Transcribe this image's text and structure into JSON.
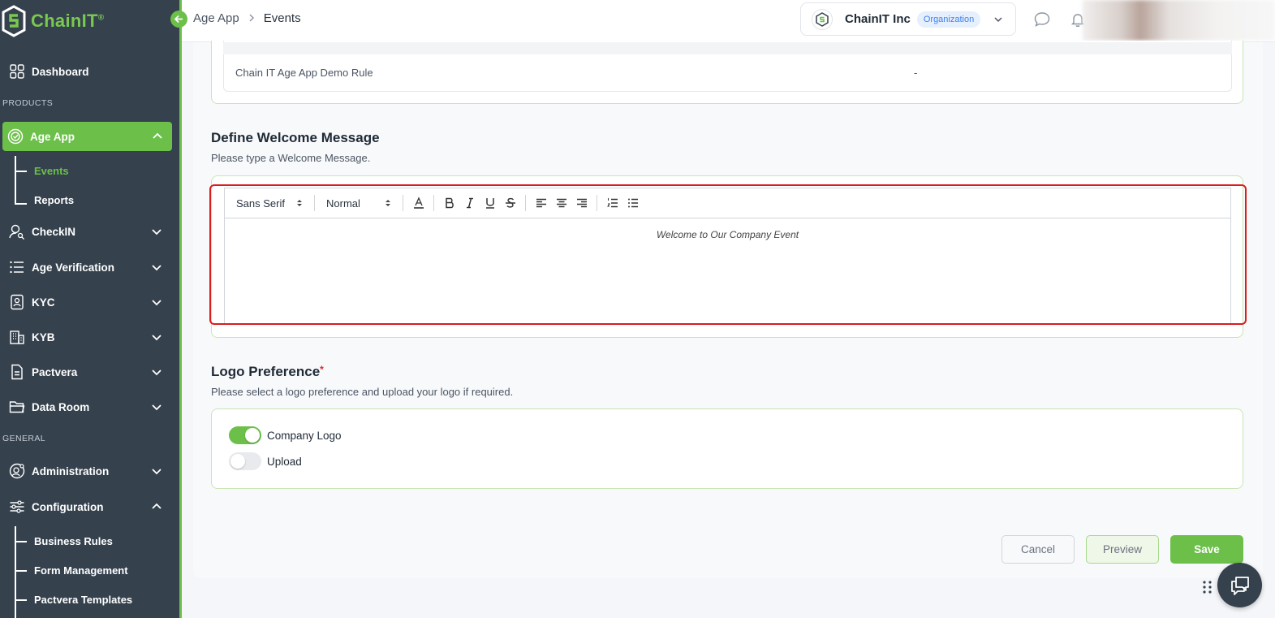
{
  "brand": {
    "name": "ChainIT",
    "reg": "®"
  },
  "sidebar": {
    "dashboard": "Dashboard",
    "section_products": "PRODUCTS",
    "age_app": "Age App",
    "age_app_sub": [
      "Events",
      "Reports"
    ],
    "checkin": "CheckIN",
    "age_verification": "Age Verification",
    "kyc": "KYC",
    "kyb": "KYB",
    "pactvera": "Pactvera",
    "data_room": "Data Room",
    "section_general": "GENERAL",
    "administration": "Administration",
    "configuration": "Configuration",
    "configuration_sub": [
      "Business Rules",
      "Form Management",
      "Pactvera Templates"
    ]
  },
  "header": {
    "breadcrumb": [
      "Age App",
      "Events"
    ],
    "org_name": "ChainIT Inc",
    "org_badge": "Organization"
  },
  "rule_table": {
    "row": {
      "name": "Chain IT Age App Demo Rule",
      "value": "-"
    }
  },
  "welcome": {
    "title": "Define Welcome Message",
    "subtitle": "Please type a Welcome Message.",
    "font_family": "Sans Serif",
    "font_size": "Normal",
    "content": "Welcome to Our Company Event"
  },
  "logo_pref": {
    "title": "Logo Preference",
    "required_mark": "*",
    "subtitle": "Please select a logo preference and upload your logo if required.",
    "options": [
      {
        "label": "Company Logo",
        "enabled": true
      },
      {
        "label": "Upload",
        "enabled": false
      }
    ]
  },
  "actions": {
    "cancel": "Cancel",
    "preview": "Preview",
    "save": "Save"
  },
  "colors": {
    "accent": "#6cc04a",
    "sidebar": "#35414d",
    "highlight": "#d91c1c"
  }
}
